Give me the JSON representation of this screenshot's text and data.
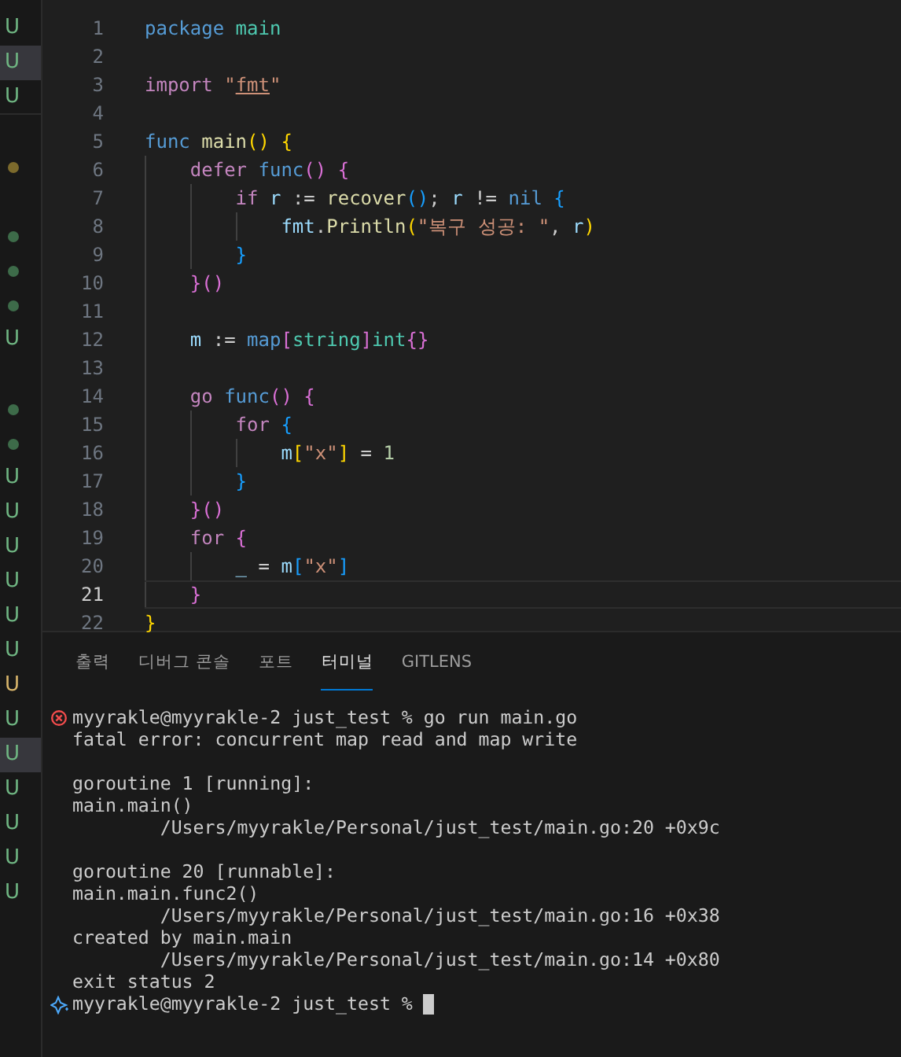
{
  "sidebar": {
    "items": [
      {
        "kind": "status",
        "letter": "U",
        "color": "#6fb582",
        "selected": false
      },
      {
        "kind": "status",
        "letter": "U",
        "color": "#6fb582",
        "selected": true
      },
      {
        "kind": "status",
        "letter": "U",
        "color": "#6fb582",
        "selected": false
      },
      {
        "kind": "blank"
      },
      {
        "kind": "dot",
        "color": "#7c6a2c"
      },
      {
        "kind": "blank"
      },
      {
        "kind": "dot",
        "color": "#3d6b49"
      },
      {
        "kind": "dot",
        "color": "#3d6b49"
      },
      {
        "kind": "dot",
        "color": "#3d6b49"
      },
      {
        "kind": "status",
        "letter": "U",
        "color": "#6fb582",
        "selected": false
      },
      {
        "kind": "blank"
      },
      {
        "kind": "dot",
        "color": "#3d6b49"
      },
      {
        "kind": "dot",
        "color": "#3d6b49"
      },
      {
        "kind": "status",
        "letter": "U",
        "color": "#6fb582",
        "selected": false
      },
      {
        "kind": "status",
        "letter": "U",
        "color": "#6fb582",
        "selected": false
      },
      {
        "kind": "status",
        "letter": "U",
        "color": "#6fb582",
        "selected": false
      },
      {
        "kind": "status",
        "letter": "U",
        "color": "#6fb582",
        "selected": false
      },
      {
        "kind": "status",
        "letter": "U",
        "color": "#6fb582",
        "selected": false
      },
      {
        "kind": "status",
        "letter": "U",
        "color": "#6fb582",
        "selected": false
      },
      {
        "kind": "status",
        "letter": "U",
        "color": "#d7b46a",
        "selected": false
      },
      {
        "kind": "status",
        "letter": "U",
        "color": "#6fb582",
        "selected": false
      },
      {
        "kind": "status",
        "letter": "U",
        "color": "#6fb582",
        "selected": true
      },
      {
        "kind": "status",
        "letter": "U",
        "color": "#6fb582",
        "selected": false
      },
      {
        "kind": "status",
        "letter": "U",
        "color": "#6fb582",
        "selected": false
      },
      {
        "kind": "status",
        "letter": "U",
        "color": "#6fb582",
        "selected": false
      },
      {
        "kind": "status",
        "letter": "U",
        "color": "#6fb582",
        "selected": false
      }
    ]
  },
  "editor": {
    "lines": [
      {
        "number": "1",
        "current": false,
        "tokens": [
          {
            "kind": "keyword",
            "text": "package "
          },
          {
            "kind": "type",
            "text": "main"
          }
        ]
      },
      {
        "number": "2",
        "current": false
      },
      {
        "number": "3",
        "current": false,
        "tokens": [
          {
            "kind": "control",
            "text": "import "
          },
          {
            "kind": "string",
            "text": "\""
          },
          {
            "kind": "link",
            "text": "fmt"
          },
          {
            "kind": "string",
            "text": "\""
          }
        ]
      },
      {
        "number": "4",
        "current": false
      },
      {
        "number": "5",
        "current": false,
        "tokens": [
          {
            "kind": "keyword",
            "text": "func "
          },
          {
            "kind": "function",
            "text": "main"
          },
          {
            "kind": "bracket1",
            "text": "() "
          },
          {
            "kind": "bracket1",
            "text": "{"
          }
        ]
      },
      {
        "number": "6",
        "current": false,
        "tokens": [
          {
            "kind": "control",
            "text": "    defer "
          },
          {
            "kind": "keyword",
            "text": "func"
          },
          {
            "kind": "bracket2",
            "text": "() "
          },
          {
            "kind": "bracket2",
            "text": "{"
          }
        ]
      },
      {
        "number": "7",
        "current": false,
        "tokens": [
          {
            "kind": "control",
            "text": "        if "
          },
          {
            "kind": "variable",
            "text": "r"
          },
          {
            "kind": "plain",
            "text": " := "
          },
          {
            "kind": "function",
            "text": "recover"
          },
          {
            "kind": "bracket3",
            "text": "()"
          },
          {
            "kind": "plain",
            "text": "; "
          },
          {
            "kind": "variable",
            "text": "r"
          },
          {
            "kind": "plain",
            "text": " != "
          },
          {
            "kind": "keyword",
            "text": "nil "
          },
          {
            "kind": "bracket3",
            "text": "{"
          }
        ]
      },
      {
        "number": "8",
        "current": false,
        "tokens": [
          {
            "kind": "variable",
            "text": "            fmt"
          },
          {
            "kind": "plain",
            "text": "."
          },
          {
            "kind": "function",
            "text": "Println"
          },
          {
            "kind": "bracket1",
            "text": "("
          },
          {
            "kind": "string",
            "text": "\"복구 성공: \""
          },
          {
            "kind": "plain",
            "text": ", "
          },
          {
            "kind": "variable",
            "text": "r"
          },
          {
            "kind": "bracket1",
            "text": ")"
          }
        ]
      },
      {
        "number": "9",
        "current": false,
        "tokens": [
          {
            "kind": "bracket3",
            "text": "        }"
          }
        ]
      },
      {
        "number": "10",
        "current": false,
        "tokens": [
          {
            "kind": "bracket2",
            "text": "    }()"
          }
        ]
      },
      {
        "number": "11",
        "current": false
      },
      {
        "number": "12",
        "current": false,
        "tokens": [
          {
            "kind": "variable",
            "text": "    m"
          },
          {
            "kind": "plain",
            "text": " := "
          },
          {
            "kind": "keyword",
            "text": "map"
          },
          {
            "kind": "bracket2",
            "text": "["
          },
          {
            "kind": "type",
            "text": "string"
          },
          {
            "kind": "bracket2",
            "text": "]"
          },
          {
            "kind": "type",
            "text": "int"
          },
          {
            "kind": "bracket2",
            "text": "{}"
          }
        ]
      },
      {
        "number": "13",
        "current": false
      },
      {
        "number": "14",
        "current": false,
        "tokens": [
          {
            "kind": "control",
            "text": "    go "
          },
          {
            "kind": "keyword",
            "text": "func"
          },
          {
            "kind": "bracket2",
            "text": "() "
          },
          {
            "kind": "bracket2",
            "text": "{"
          }
        ]
      },
      {
        "number": "15",
        "current": false,
        "tokens": [
          {
            "kind": "control",
            "text": "        for "
          },
          {
            "kind": "bracket3",
            "text": "{"
          }
        ]
      },
      {
        "number": "16",
        "current": false,
        "tokens": [
          {
            "kind": "variable",
            "text": "            m"
          },
          {
            "kind": "bracket1",
            "text": "["
          },
          {
            "kind": "string",
            "text": "\"x\""
          },
          {
            "kind": "bracket1",
            "text": "]"
          },
          {
            "kind": "plain",
            "text": " = "
          },
          {
            "kind": "number",
            "text": "1"
          }
        ]
      },
      {
        "number": "17",
        "current": false,
        "tokens": [
          {
            "kind": "bracket3",
            "text": "        }"
          }
        ]
      },
      {
        "number": "18",
        "current": false,
        "tokens": [
          {
            "kind": "bracket2",
            "text": "    }()"
          }
        ]
      },
      {
        "number": "19",
        "current": false,
        "tokens": [
          {
            "kind": "control",
            "text": "    for "
          },
          {
            "kind": "bracket2",
            "text": "{"
          }
        ]
      },
      {
        "number": "20",
        "current": false,
        "tokens": [
          {
            "kind": "variable",
            "text": "        _"
          },
          {
            "kind": "plain",
            "text": " = "
          },
          {
            "kind": "variable",
            "text": "m"
          },
          {
            "kind": "bracket3",
            "text": "["
          },
          {
            "kind": "string",
            "text": "\"x\""
          },
          {
            "kind": "bracket3",
            "text": "]"
          }
        ]
      },
      {
        "number": "21",
        "current": true,
        "tokens": [
          {
            "kind": "bracket2",
            "text": "    }"
          }
        ]
      },
      {
        "number": "22",
        "current": false,
        "tokens": [
          {
            "kind": "bracket1",
            "text": "}"
          }
        ]
      }
    ]
  },
  "panel": {
    "tabs": [
      {
        "label": "출력",
        "selected": false
      },
      {
        "label": "디버그 콘솔",
        "selected": false
      },
      {
        "label": "포트",
        "selected": false
      },
      {
        "label": "터미널",
        "selected": true
      },
      {
        "label": "GITLENS",
        "selected": false
      }
    ],
    "terminal": {
      "lines": [
        {
          "kind": "prompt-error",
          "text": "myyrakle@myyrakle-2 just_test % go run main.go"
        },
        {
          "kind": "output",
          "text": "fatal error: concurrent map read and map write"
        },
        {
          "kind": "blank"
        },
        {
          "kind": "output",
          "text": "goroutine 1 [running]:"
        },
        {
          "kind": "output",
          "text": "main.main()"
        },
        {
          "kind": "output",
          "text": "        /Users/myyrakle/Personal/just_test/main.go:20 +0x9c"
        },
        {
          "kind": "blank"
        },
        {
          "kind": "output",
          "text": "goroutine 20 [runnable]:"
        },
        {
          "kind": "output",
          "text": "main.main.func2()"
        },
        {
          "kind": "output",
          "text": "        /Users/myyrakle/Personal/just_test/main.go:16 +0x38"
        },
        {
          "kind": "output",
          "text": "created by main.main"
        },
        {
          "kind": "output",
          "text": "        /Users/myyrakle/Personal/just_test/main.go:14 +0x80"
        },
        {
          "kind": "output",
          "text": "exit status 2"
        },
        {
          "kind": "prompt-active",
          "text": "myyrakle@myyrakle-2 just_test %"
        }
      ]
    }
  }
}
